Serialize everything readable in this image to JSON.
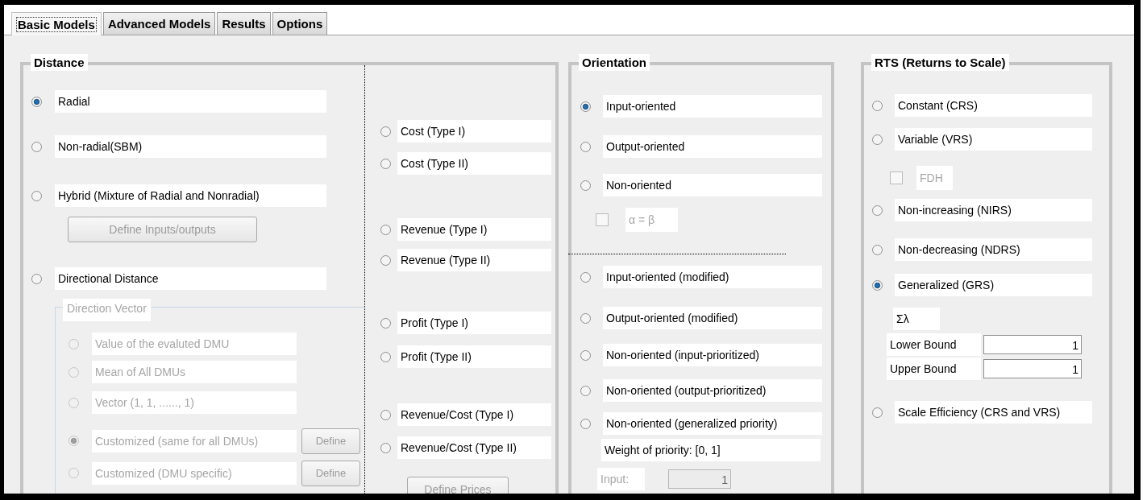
{
  "tabs": [
    {
      "label": "Basic Models",
      "selected": true
    },
    {
      "label": "Advanced Models",
      "selected": false
    },
    {
      "label": "Results",
      "selected": false
    },
    {
      "label": "Options",
      "selected": false
    }
  ],
  "distance": {
    "title": "Distance",
    "left": [
      {
        "kind": "radio",
        "label": "Radial",
        "selected": true
      },
      {
        "kind": "radio",
        "label": "Non-radial(SBM)",
        "selected": false
      },
      {
        "kind": "radio",
        "label": "Hybrid (Mixture of Radial and Nonradial)",
        "selected": false
      },
      {
        "kind": "button",
        "label": "Define Inputs/outputs",
        "disabled": true
      },
      {
        "kind": "radio",
        "label": "Directional Distance",
        "selected": false
      },
      {
        "kind": "group",
        "title": "Direction Vector",
        "disabled": true,
        "items": [
          {
            "label": "Value of the evaluted DMU",
            "selected": false,
            "disabled": true
          },
          {
            "label": "Mean of All DMUs",
            "selected": false,
            "disabled": true
          },
          {
            "label": "Vector  (1, 1,  ......, 1)",
            "selected": false,
            "disabled": true
          },
          {
            "label": "Customized (same for all DMUs)",
            "selected": true,
            "disabled": true,
            "button": {
              "label": "Define",
              "disabled": true
            }
          },
          {
            "label": "Customized (DMU specific)",
            "selected": false,
            "disabled": true,
            "button": {
              "label": "Define",
              "disabled": true
            }
          }
        ]
      }
    ],
    "right": [
      {
        "kind": "radio",
        "label": "Cost (Type I)",
        "selected": false
      },
      {
        "kind": "radio",
        "label": "Cost (Type II)",
        "selected": false
      },
      {
        "kind": "radio",
        "label": "Revenue (Type I)",
        "selected": false
      },
      {
        "kind": "radio",
        "label": "Revenue (Type II)",
        "selected": false
      },
      {
        "kind": "radio",
        "label": "Profit (Type I)",
        "selected": false
      },
      {
        "kind": "radio",
        "label": "Profit (Type II)",
        "selected": false
      },
      {
        "kind": "radio",
        "label": "Revenue/Cost (Type I)",
        "selected": false
      },
      {
        "kind": "radio",
        "label": "Revenue/Cost (Type II)",
        "selected": false
      },
      {
        "kind": "button",
        "label": "Define Prices",
        "disabled": true
      }
    ]
  },
  "orientation": {
    "title": "Orientation",
    "items": [
      {
        "kind": "radio",
        "label": "Input-oriented",
        "selected": true
      },
      {
        "kind": "radio",
        "label": "Output-oriented",
        "selected": false
      },
      {
        "kind": "radio",
        "label": "Non-oriented",
        "selected": false
      },
      {
        "kind": "checkbox",
        "label": "α = β",
        "checked": false,
        "disabled": true
      },
      {
        "kind": "separator"
      },
      {
        "kind": "radio",
        "label": "Input-oriented (modified)",
        "selected": false
      },
      {
        "kind": "radio",
        "label": "Output-oriented (modified)",
        "selected": false
      },
      {
        "kind": "radio",
        "label": "Non-oriented (input-prioritized)",
        "selected": false
      },
      {
        "kind": "radio",
        "label": "Non-oriented (output-prioritized)",
        "selected": false
      },
      {
        "kind": "radio",
        "label": "Non-oriented (generalized priority)",
        "selected": false
      },
      {
        "kind": "text",
        "label": "Weight of priority:  [0, 1]"
      },
      {
        "kind": "field",
        "label": "Input:",
        "value": "1",
        "disabled": true
      }
    ]
  },
  "rts": {
    "title": "RTS (Returns to Scale)",
    "items": [
      {
        "kind": "radio",
        "label": "Constant (CRS)",
        "selected": false
      },
      {
        "kind": "radio",
        "label": "Variable (VRS)",
        "selected": false
      },
      {
        "kind": "checkbox",
        "label": "FDH",
        "checked": false,
        "disabled": true
      },
      {
        "kind": "radio",
        "label": "Non-increasing (NIRS)",
        "selected": false
      },
      {
        "kind": "radio",
        "label": "Non-decreasing (NDRS)",
        "selected": false
      },
      {
        "kind": "radio",
        "label": "Generalized (GRS)",
        "selected": true
      },
      {
        "kind": "text",
        "label": "Σλ"
      },
      {
        "kind": "field",
        "label": "Lower Bound",
        "value": "1",
        "disabled": false
      },
      {
        "kind": "field",
        "label": "Upper Bound",
        "value": "1",
        "disabled": false
      },
      {
        "kind": "radio",
        "label": "Scale Efficiency (CRS and VRS)",
        "selected": false
      }
    ]
  }
}
